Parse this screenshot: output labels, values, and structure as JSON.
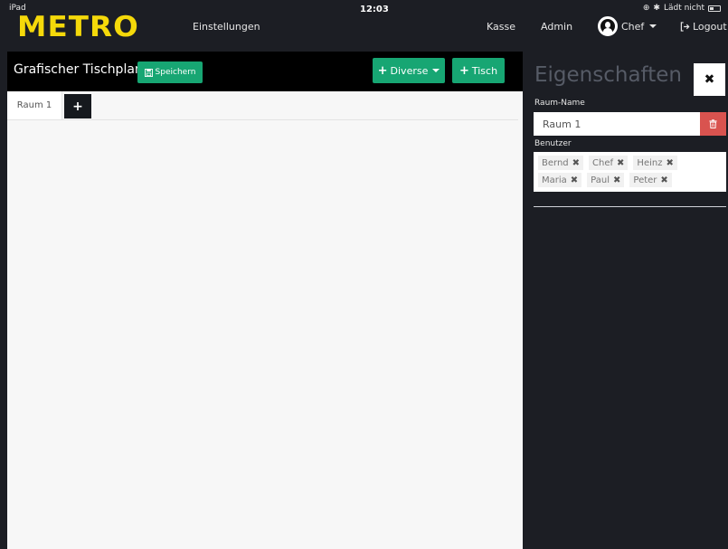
{
  "status_bar": {
    "device": "iPad",
    "time": "12:03",
    "charging": "Lädt nicht"
  },
  "nav": {
    "logo": "METRO",
    "einstellungen": "Einstellungen",
    "kasse": "Kasse",
    "admin": "Admin",
    "user": "Chef",
    "logout": "Logout"
  },
  "editor": {
    "title": "Grafischer Tischplan",
    "save_label": "Speichern",
    "diverse_label": "Diverse",
    "tisch_label": "Tisch"
  },
  "tabs": [
    {
      "label": "Raum 1"
    }
  ],
  "panel": {
    "title": "Eigenschaften",
    "room_name_label": "Raum-Name",
    "room_name_value": "Raum 1",
    "users_label": "Benutzer",
    "users": [
      "Bernd",
      "Chef",
      "Heinz",
      "Maria",
      "Paul",
      "Peter"
    ]
  },
  "colors": {
    "logo": "#f5d90a",
    "accent_green": "#17a673",
    "danger_red": "#d9534f",
    "background_dark": "#1c1e24"
  }
}
